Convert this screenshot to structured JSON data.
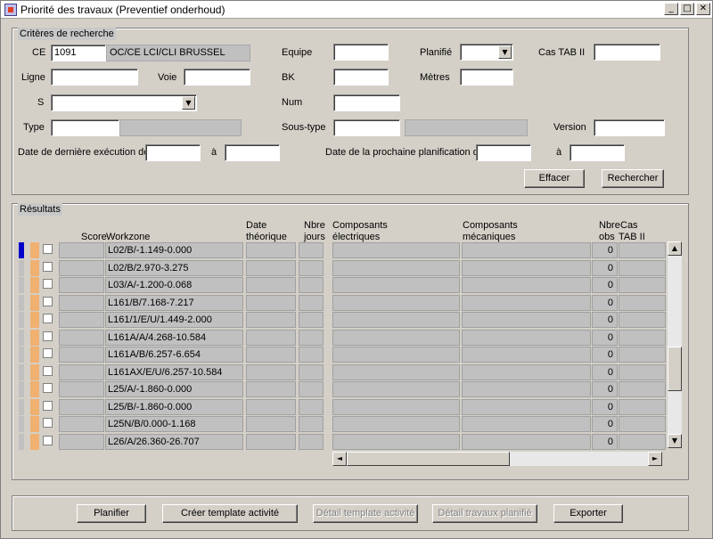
{
  "window": {
    "title": "Priorité des travaux (Preventief onderhoud)"
  },
  "criteria": {
    "group_title": "Critères de recherche",
    "ce_label": "CE",
    "ce_value": "1091",
    "ce_desc": "OC/CE LCI/CLI BRUSSEL",
    "equipe_label": "Equipe",
    "planifie_label": "Planifié",
    "cas_tab_label": "Cas TAB II",
    "ligne_label": "Ligne",
    "voie_label": "Voie",
    "bk_label": "BK",
    "metres_label": "Mètres",
    "s_label": "S",
    "num_label": "Num",
    "type_label": "Type",
    "sous_type_label": "Sous-type",
    "version_label": "Version",
    "date_derniere_label": "Date de dernière exécution de",
    "a_label_1": "à",
    "date_prochaine_label": "Date de la prochaine planification de",
    "a_label_2": "à",
    "effacer_label": "Effacer",
    "rechercher_label": "Rechercher"
  },
  "results": {
    "group_title": "Résultats",
    "headers": {
      "score": "Score",
      "workzone": "Workzone",
      "date_line1": "Date",
      "date_line2": "théorique",
      "nbre_line1": "Nbre",
      "nbre_line2": "jours",
      "comp_el_line1": "Composants",
      "comp_el_line2": "électriques",
      "comp_mec_line1": "Composants",
      "comp_mec_line2": "mécaniques",
      "nbre_obs_line1": "Nbre",
      "nbre_obs_line2": "obs",
      "cas_line1": "Cas",
      "cas_line2": "TAB II"
    },
    "rows": [
      {
        "workzone": "L02/B/-1.149-0.000",
        "obs": "0"
      },
      {
        "workzone": "L02/B/2.970-3.275",
        "obs": "0"
      },
      {
        "workzone": "L03/A/-1.200-0.068",
        "obs": "0"
      },
      {
        "workzone": "L161/B/7.168-7.217",
        "obs": "0"
      },
      {
        "workzone": "L161/1/E/U/1.449-2.000",
        "obs": "0"
      },
      {
        "workzone": "L161A/A/4.268-10.584",
        "obs": "0"
      },
      {
        "workzone": "L161A/B/6.257-6.654",
        "obs": "0"
      },
      {
        "workzone": "L161AX/E/U/6.257-10.584",
        "obs": "0"
      },
      {
        "workzone": "L25/A/-1.860-0.000",
        "obs": "0"
      },
      {
        "workzone": "L25/B/-1.860-0.000",
        "obs": "0"
      },
      {
        "workzone": "L25N/B/0.000-1.168",
        "obs": "0"
      },
      {
        "workzone": "L26/A/26.360-26.707",
        "obs": "0"
      }
    ]
  },
  "actions": {
    "planifier": "Planifier",
    "creer_template": "Créer template activité",
    "detail_template": "Détail template activité",
    "detail_travaux": "Détail travaux planifié",
    "exporter": "Exporter"
  },
  "icons": {
    "minimize": "_",
    "maximize": "□",
    "close": "✕",
    "dropdown": "▼",
    "up": "▲",
    "down": "▼",
    "left": "◄",
    "right": "►"
  }
}
